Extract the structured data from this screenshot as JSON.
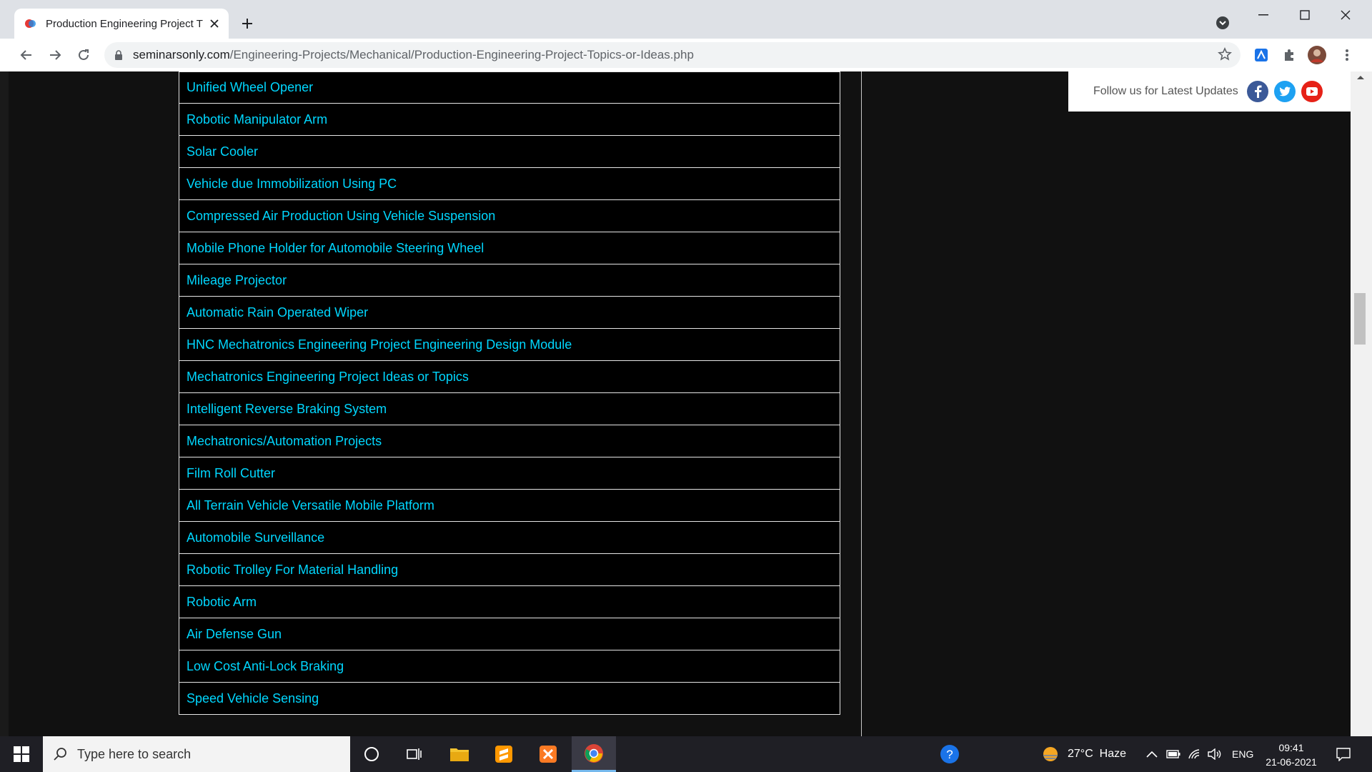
{
  "browser": {
    "tab_title": "Production Engineering Project T",
    "url_domain": "seminarsonly.com",
    "url_path": "/Engineering-Projects/Mechanical/Production-Engineering-Project-Topics-or-Ideas.php"
  },
  "page": {
    "follow_text": "Follow us for Latest Updates",
    "social_icons": [
      "facebook-icon",
      "twitter-icon",
      "youtube-icon"
    ],
    "link_color": "#00d7ff",
    "projects": [
      "Unified Wheel Opener",
      "Robotic Manipulator Arm",
      "Solar Cooler",
      "Vehicle due Immobilization Using PC",
      "Compressed Air Production Using Vehicle Suspension",
      "Mobile Phone Holder for Automobile Steering Wheel",
      "Mileage Projector",
      "Automatic Rain Operated Wiper",
      "HNC Mechatronics Engineering Project Engineering Design Module",
      "Mechatronics Engineering Project Ideas or Topics",
      "Intelligent Reverse Braking System",
      "Mechatronics/Automation Projects",
      "Film Roll Cutter",
      "All Terrain Vehicle Versatile Mobile Platform",
      "Automobile Surveillance",
      "Robotic Trolley For Material Handling",
      "Robotic Arm",
      "Air Defense Gun",
      "Low Cost Anti-Lock Braking",
      "Speed Vehicle Sensing"
    ]
  },
  "taskbar": {
    "search_placeholder": "Type here to search",
    "weather": "27°C  Haze",
    "language": "ENG",
    "time": "09:41",
    "date": "21-06-2021"
  }
}
